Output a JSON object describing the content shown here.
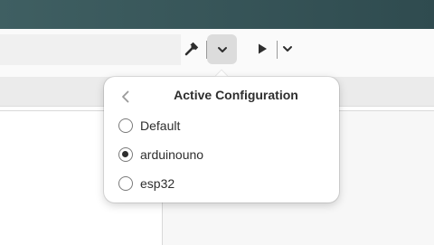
{
  "colors": {
    "titlebar": "#2f4b4f",
    "toolbar": "#fafafa",
    "active_button": "#dcdcdc",
    "popover_bg": "#ffffff",
    "text": "#2e2e2e"
  },
  "toolbar": {
    "build_icon": "hammer-icon",
    "build_menu_icon": "chevron-down-icon",
    "run_icon": "play-icon",
    "run_menu_icon": "chevron-down-icon"
  },
  "popover": {
    "back_icon": "chevron-left-icon",
    "title": "Active Configuration",
    "options": [
      {
        "label": "Default",
        "selected": false
      },
      {
        "label": "arduinouno",
        "selected": true
      },
      {
        "label": "esp32",
        "selected": false
      }
    ]
  }
}
